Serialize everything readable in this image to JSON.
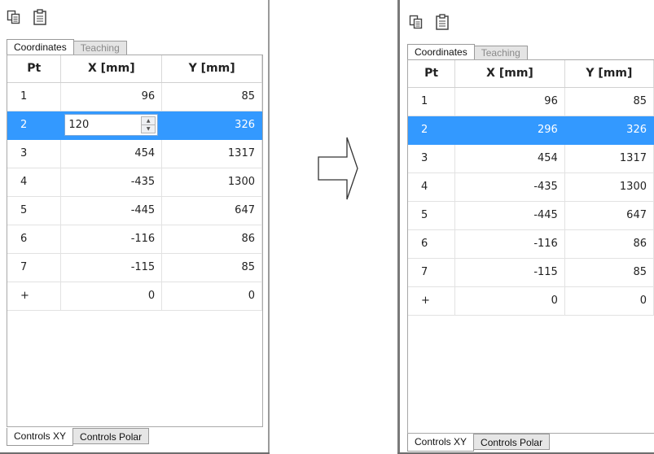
{
  "tabs_top": [
    "Coordinates",
    "Teaching"
  ],
  "tabs_bottom": [
    "Controls XY",
    "Controls Polar"
  ],
  "columns": [
    "Pt",
    "X [mm]",
    "Y [mm]"
  ],
  "toolbar": {
    "icons": [
      "copy-icon",
      "paste-icon"
    ]
  },
  "colors": {
    "selection": "#3399ff",
    "selection_text": "#ffffff"
  },
  "before": {
    "rows": [
      {
        "pt": "1",
        "x": "96",
        "y": "85"
      },
      {
        "pt": "2",
        "x": "120",
        "y": "326"
      },
      {
        "pt": "3",
        "x": "454",
        "y": "1317"
      },
      {
        "pt": "4",
        "x": "-435",
        "y": "1300"
      },
      {
        "pt": "5",
        "x": "-445",
        "y": "647"
      },
      {
        "pt": "6",
        "x": "-116",
        "y": "86"
      },
      {
        "pt": "7",
        "x": "-115",
        "y": "85"
      },
      {
        "pt": "+",
        "x": "0",
        "y": "0"
      }
    ],
    "selected_pt": "2",
    "editing": "X [mm]"
  },
  "after": {
    "rows": [
      {
        "pt": "1",
        "x": "96",
        "y": "85"
      },
      {
        "pt": "2",
        "x": "296",
        "y": "326"
      },
      {
        "pt": "3",
        "x": "454",
        "y": "1317"
      },
      {
        "pt": "4",
        "x": "-435",
        "y": "1300"
      },
      {
        "pt": "5",
        "x": "-445",
        "y": "647"
      },
      {
        "pt": "6",
        "x": "-116",
        "y": "86"
      },
      {
        "pt": "7",
        "x": "-115",
        "y": "85"
      },
      {
        "pt": "+",
        "x": "0",
        "y": "0"
      }
    ],
    "selected_pt": "2"
  },
  "arrow_icon": "right-arrow-outline-icon"
}
